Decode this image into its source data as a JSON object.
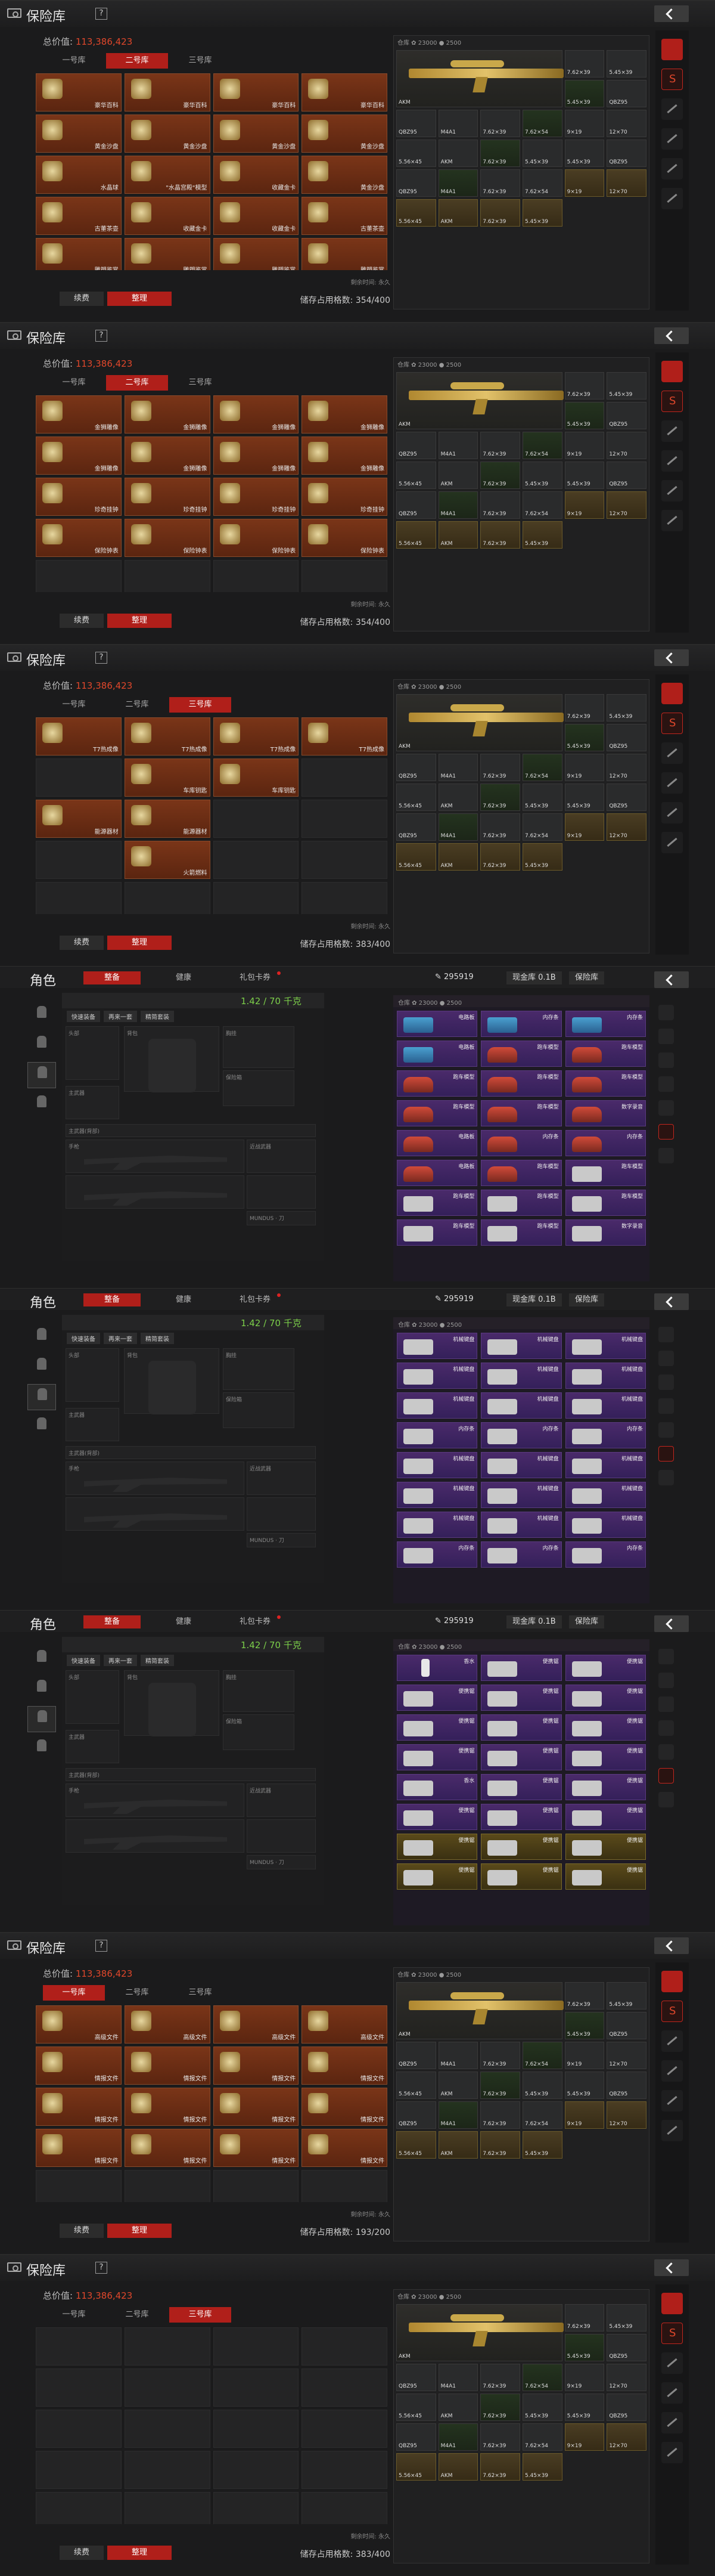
{
  "header_title": "保险库",
  "help": "?",
  "total_label": "总价值:",
  "total_value": "113,386,423",
  "tabs": [
    "一号库",
    "二号库",
    "三号库"
  ],
  "sort_btn": "整理",
  "renew_btn": "续费",
  "cap_label": "储存占用格数:",
  "term": "剩余时间: 永久",
  "panels": [
    {
      "tab": 1,
      "cap": "354/400",
      "items": [
        "豪华百科",
        "豪华百科",
        "豪华百科",
        "豪华百科",
        "黄金沙盘",
        "黄金沙盘",
        "黄金沙盘",
        "黄金沙盘",
        "水晶球",
        "\"水晶宫殿\"模型",
        "收藏金卡",
        "黄金沙盘",
        "古董茶壶",
        "收藏金卡",
        "收藏金卡",
        "古董茶壶",
        "雕塑鉴赏",
        "雕塑鉴赏",
        "雕塑鉴赏",
        "雕塑鉴赏"
      ]
    },
    {
      "tab": 1,
      "cap": "354/400",
      "items": [
        "金狮雕像",
        "金狮雕像",
        "金狮雕像",
        "金狮雕像",
        "金狮雕像",
        "金狮雕像",
        "金狮雕像",
        "金狮雕像",
        "珍奇挂钟",
        "珍奇挂钟",
        "珍奇挂钟",
        "珍奇挂钟",
        "保险钟表",
        "保险钟表",
        "保险钟表",
        "保险钟表",
        "",
        "",
        "",
        ""
      ]
    },
    {
      "tab": 2,
      "cap": "383/400",
      "items": [
        "T7热成像",
        "T7热成像",
        "T7热成像",
        "T7热成像",
        "",
        "车库钥匙",
        "车库钥匙",
        "",
        "能源器材",
        "能源器材",
        "",
        "",
        "",
        "火箭燃料",
        "",
        "",
        "",
        "",
        "",
        "",
        ""
      ]
    },
    {
      "tab": 0,
      "cap": "193/200",
      "items": [
        "高级文件",
        "高级文件",
        "高级文件",
        "高级文件",
        "情报文件",
        "情报文件",
        "情报文件",
        "情报文件",
        "情报文件",
        "情报文件",
        "情报文件",
        "情报文件",
        "情报文件",
        "情报文件",
        "情报文件",
        "情报文件",
        "",
        "",
        "",
        ""
      ]
    },
    {
      "tab": 2,
      "cap": "383/400",
      "items": [
        "",
        "",
        "",
        "",
        "",
        "",
        "",
        "",
        "",
        "",
        "",
        "",
        "",
        "",
        "",
        "",
        "",
        "",
        "",
        ""
      ]
    }
  ],
  "right_head": "仓库 ✿ 23000 ● 2500",
  "right_labels": [
    "AKM",
    "7.62×39",
    "5.45×39",
    "5.45×39",
    "QBZ95",
    "QBZ95",
    "M4A1",
    "7.62×39",
    "7.62×54",
    "9×19",
    "12×70",
    "5.56×45"
  ],
  "char": {
    "title": "角色",
    "tabs": [
      "整备",
      "健康",
      "礼包卡券"
    ],
    "money": "295919",
    "cash": "现金库 0.1B",
    "safe": "保险库",
    "count": "1.42 / 70 千克",
    "btns": [
      "快速装备",
      "再来一套",
      "精简套装"
    ],
    "slots": [
      "头部",
      "背包",
      "胸挂",
      "保险箱",
      "主武器",
      "主武器(背部)",
      "手枪",
      "近战武器"
    ],
    "melee": "MUNDUS · 刀",
    "inv_head": "仓库 ✿ 23000 ● 2500",
    "inv_labels_1": [
      "电路板",
      "内存条",
      "内存条",
      "电路板",
      "跑车模型",
      "跑车模型",
      "跑车模型",
      "跑车模型",
      "跑车模型",
      "跑车模型",
      "跑车模型",
      "数字录音"
    ],
    "inv_labels_2": [
      "机械键盘",
      "机械键盘",
      "机械键盘",
      "机械键盘",
      "机械键盘",
      "机械键盘",
      "机械键盘",
      "机械键盘",
      "机械键盘",
      "内存条",
      "内存条",
      "内存条"
    ],
    "inv_labels_3": [
      "香水",
      "便携锯",
      "便携锯",
      "便携锯",
      "便携锯",
      "便携锯",
      "便携锯",
      "便携锯",
      "便携锯",
      "便携锯",
      "便携锯",
      "便携锯"
    ]
  }
}
